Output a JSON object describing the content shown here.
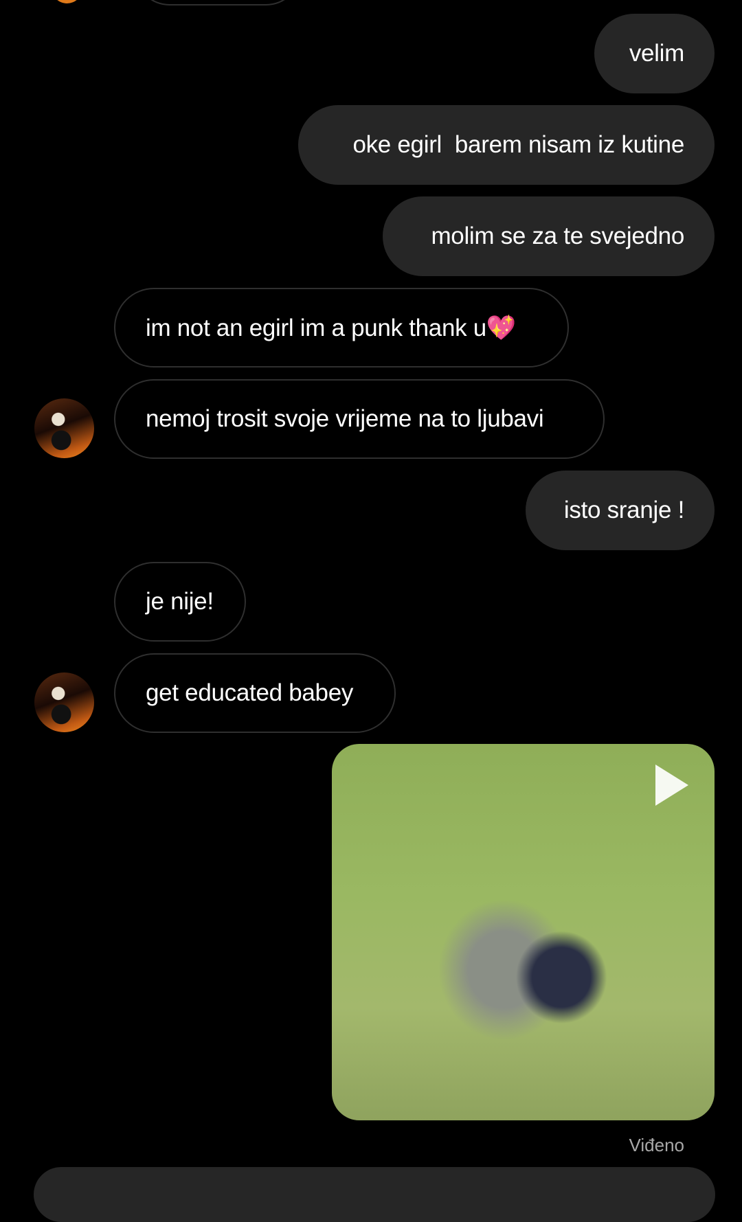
{
  "messages": [
    {
      "direction": "outgoing",
      "text": "velim"
    },
    {
      "direction": "outgoing",
      "text": "oke egirl  barem nisam iz kutine"
    },
    {
      "direction": "outgoing",
      "text": "molim se za te svejedno"
    },
    {
      "direction": "incoming",
      "text": "im not an egirl im a punk thank u💖"
    },
    {
      "direction": "incoming",
      "text": "nemoj trosit svoje vrijeme na to ljubavi",
      "avatar": true
    },
    {
      "direction": "outgoing",
      "text": "isto sranje !"
    },
    {
      "direction": "incoming",
      "text": "je nije!"
    },
    {
      "direction": "incoming",
      "text": "get educated babey",
      "avatar": true
    },
    {
      "direction": "outgoing",
      "type": "video",
      "icon": "play-icon"
    }
  ],
  "status": {
    "seen_label": "Viđeno"
  },
  "colors": {
    "outgoing_bubble": "#262626",
    "incoming_border": "#2f2f2f",
    "background": "#000000"
  }
}
